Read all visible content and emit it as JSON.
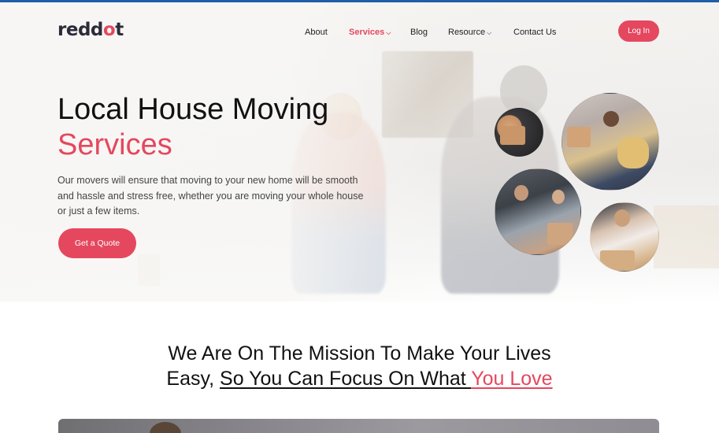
{
  "brand": {
    "logo_text_a": "redd",
    "logo_text_b": "o",
    "logo_text_c": "t",
    "accent": "#e5475f",
    "dark": "#2b2b3a"
  },
  "nav": {
    "items": [
      {
        "label": "About",
        "active": false,
        "has_dropdown": false
      },
      {
        "label": "Services",
        "active": true,
        "has_dropdown": true
      },
      {
        "label": "Blog",
        "active": false,
        "has_dropdown": false
      },
      {
        "label": "Resource",
        "active": false,
        "has_dropdown": true
      },
      {
        "label": "Contact Us",
        "active": false,
        "has_dropdown": false
      }
    ],
    "chevron": "⌵",
    "login_label": "Log In"
  },
  "hero": {
    "title_line1": "Local House Moving",
    "title_line2": "Services",
    "description": "Our movers will ensure that moving to your new home will be smooth and hassle and stress free, whether you are moving your whole house or just a few items.",
    "cta_label": "Get a Quote"
  },
  "mission": {
    "line1": "We Are On The Mission To Make Your Lives",
    "line2_plain": "Easy, ",
    "line2_underlined": "So You Can Focus On What ",
    "line2_accent": "You Love"
  }
}
